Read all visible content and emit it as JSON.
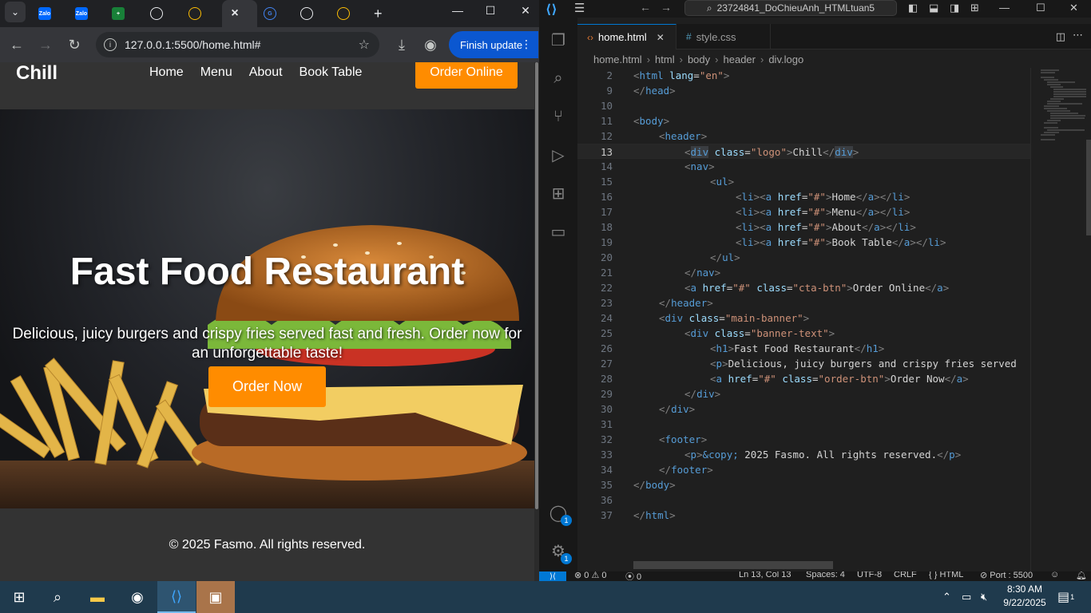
{
  "browser": {
    "tabs": [
      {
        "icon": "zalo-icon",
        "fav_text": "Zalo",
        "color": "#0068ff"
      },
      {
        "icon": "zalo-icon",
        "fav_text": "Zalo",
        "color": "#0068ff"
      },
      {
        "icon": "sheets-icon",
        "fav_text": "+",
        "color": "#188038"
      },
      {
        "icon": "chatgpt-icon",
        "fav_text": "",
        "color": "#e8eaed"
      },
      {
        "icon": "drive-icon",
        "fav_text": "",
        "color": "#fbbc04"
      },
      {
        "icon": "close-icon",
        "fav_text": "×",
        "color": "#e8eaed"
      },
      {
        "icon": "google-icon",
        "fav_text": "G",
        "color": "#4285f4"
      },
      {
        "icon": "github-icon",
        "fav_text": "",
        "color": "#e8eaed"
      },
      {
        "icon": "drive-icon",
        "fav_text": "",
        "color": "#fbbc04"
      }
    ],
    "new_tab": "+",
    "url": "127.0.0.1:5500/home.html#",
    "finish_update": "Finish update"
  },
  "site": {
    "logo": "Chill",
    "nav": [
      "Home",
      "Menu",
      "About",
      "Book Table"
    ],
    "cta": "Order Online",
    "banner_title": "Fast Food Restaurant",
    "banner_desc": "Delicious, juicy burgers and crispy fries served fast and fresh. Order now for an unforgettable taste!",
    "order_btn": "Order Now",
    "footer": "© 2025 Fasmo. All rights reserved.",
    "accent_color": "#ff8c00"
  },
  "vscode": {
    "search": "23724841_DoChieuAnh_HTMLtuan5",
    "tabs": [
      {
        "label": "home.html",
        "icon": "html-icon",
        "active": true
      },
      {
        "label": "style.css",
        "icon": "css-icon",
        "active": false
      }
    ],
    "breadcrumbs": [
      "home.html",
      "html",
      "body",
      "header",
      "div.logo"
    ],
    "lines": [
      {
        "n": "2",
        "indent": 0,
        "html": "<span class='t'>&lt;</span><span class='n'>html</span> <span class='a'>lang</span>=<span class='s'>\"en\"</span><span class='t'>&gt;</span>"
      },
      {
        "n": "9",
        "indent": 0,
        "html": "<span class='t'>&lt;/</span><span class='n'>head</span><span class='t'>&gt;</span>"
      },
      {
        "n": "10",
        "indent": 0,
        "html": ""
      },
      {
        "n": "11",
        "indent": 0,
        "html": "<span class='t'>&lt;</span><span class='n'>body</span><span class='t'>&gt;</span>"
      },
      {
        "n": "12",
        "indent": 1,
        "html": "<span class='t'>&lt;</span><span class='n'>header</span><span class='t'>&gt;</span>"
      },
      {
        "n": "13",
        "indent": 2,
        "html": "<span class='t'>&lt;</span><span class='n hl'>div</span> <span class='a'>class</span>=<span class='s'>\"logo\"</span><span class='t'>&gt;</span><span class='tx'>Chill</span><span class='t'>&lt;/</span><span class='n hl'>div</span><span class='t'>&gt;</span>"
      },
      {
        "n": "14",
        "indent": 2,
        "html": "<span class='t'>&lt;</span><span class='n'>nav</span><span class='t'>&gt;</span>"
      },
      {
        "n": "15",
        "indent": 3,
        "html": "<span class='t'>&lt;</span><span class='n'>ul</span><span class='t'>&gt;</span>"
      },
      {
        "n": "16",
        "indent": 4,
        "html": "<span class='t'>&lt;</span><span class='n'>li</span><span class='t'>&gt;&lt;</span><span class='n'>a</span> <span class='a'>href</span>=<span class='s'>\"#\"</span><span class='t'>&gt;</span><span class='tx'>Home</span><span class='t'>&lt;/</span><span class='n'>a</span><span class='t'>&gt;&lt;/</span><span class='n'>li</span><span class='t'>&gt;</span>"
      },
      {
        "n": "17",
        "indent": 4,
        "html": "<span class='t'>&lt;</span><span class='n'>li</span><span class='t'>&gt;&lt;</span><span class='n'>a</span> <span class='a'>href</span>=<span class='s'>\"#\"</span><span class='t'>&gt;</span><span class='tx'>Menu</span><span class='t'>&lt;/</span><span class='n'>a</span><span class='t'>&gt;&lt;/</span><span class='n'>li</span><span class='t'>&gt;</span>"
      },
      {
        "n": "18",
        "indent": 4,
        "html": "<span class='t'>&lt;</span><span class='n'>li</span><span class='t'>&gt;&lt;</span><span class='n'>a</span> <span class='a'>href</span>=<span class='s'>\"#\"</span><span class='t'>&gt;</span><span class='tx'>About</span><span class='t'>&lt;/</span><span class='n'>a</span><span class='t'>&gt;&lt;/</span><span class='n'>li</span><span class='t'>&gt;</span>"
      },
      {
        "n": "19",
        "indent": 4,
        "html": "<span class='t'>&lt;</span><span class='n'>li</span><span class='t'>&gt;&lt;</span><span class='n'>a</span> <span class='a'>href</span>=<span class='s'>\"#\"</span><span class='t'>&gt;</span><span class='tx'>Book Table</span><span class='t'>&lt;/</span><span class='n'>a</span><span class='t'>&gt;&lt;/</span><span class='n'>li</span><span class='t'>&gt;</span>"
      },
      {
        "n": "20",
        "indent": 3,
        "html": "<span class='t'>&lt;/</span><span class='n'>ul</span><span class='t'>&gt;</span>"
      },
      {
        "n": "21",
        "indent": 2,
        "html": "<span class='t'>&lt;/</span><span class='n'>nav</span><span class='t'>&gt;</span>"
      },
      {
        "n": "22",
        "indent": 2,
        "html": "<span class='t'>&lt;</span><span class='n'>a</span> <span class='a'>href</span>=<span class='s'>\"#\"</span> <span class='a'>class</span>=<span class='s'>\"cta-btn\"</span><span class='t'>&gt;</span><span class='tx'>Order Online</span><span class='t'>&lt;/</span><span class='n'>a</span><span class='t'>&gt;</span>"
      },
      {
        "n": "23",
        "indent": 1,
        "html": "<span class='t'>&lt;/</span><span class='n'>header</span><span class='t'>&gt;</span>"
      },
      {
        "n": "24",
        "indent": 1,
        "html": "<span class='t'>&lt;</span><span class='n'>div</span> <span class='a'>class</span>=<span class='s'>\"main-banner\"</span><span class='t'>&gt;</span>"
      },
      {
        "n": "25",
        "indent": 2,
        "html": "<span class='t'>&lt;</span><span class='n'>div</span> <span class='a'>class</span>=<span class='s'>\"banner-text\"</span><span class='t'>&gt;</span>"
      },
      {
        "n": "26",
        "indent": 3,
        "html": "<span class='t'>&lt;</span><span class='n'>h1</span><span class='t'>&gt;</span><span class='tx'>Fast Food Restaurant</span><span class='t'>&lt;/</span><span class='n'>h1</span><span class='t'>&gt;</span>"
      },
      {
        "n": "27",
        "indent": 3,
        "html": "<span class='t'>&lt;</span><span class='n'>p</span><span class='t'>&gt;</span><span class='tx'>Delicious, juicy burgers and crispy fries served</span>"
      },
      {
        "n": "28",
        "indent": 3,
        "html": "<span class='t'>&lt;</span><span class='n'>a</span> <span class='a'>href</span>=<span class='s'>\"#\"</span> <span class='a'>class</span>=<span class='s'>\"order-btn\"</span><span class='t'>&gt;</span><span class='tx'>Order Now</span><span class='t'>&lt;/</span><span class='n'>a</span><span class='t'>&gt;</span>"
      },
      {
        "n": "29",
        "indent": 2,
        "html": "<span class='t'>&lt;/</span><span class='n'>div</span><span class='t'>&gt;</span>"
      },
      {
        "n": "30",
        "indent": 1,
        "html": "<span class='t'>&lt;/</span><span class='n'>div</span><span class='t'>&gt;</span>"
      },
      {
        "n": "31",
        "indent": 0,
        "html": ""
      },
      {
        "n": "32",
        "indent": 1,
        "html": "<span class='t'>&lt;</span><span class='n'>footer</span><span class='t'>&gt;</span>"
      },
      {
        "n": "33",
        "indent": 2,
        "html": "<span class='t'>&lt;</span><span class='n'>p</span><span class='t'>&gt;</span><span class='n'>&amp;copy;</span><span class='tx'> 2025 Fasmo. All rights reserved.</span><span class='t'>&lt;/</span><span class='n'>p</span><span class='t'>&gt;</span>"
      },
      {
        "n": "34",
        "indent": 1,
        "html": "<span class='t'>&lt;/</span><span class='n'>footer</span><span class='t'>&gt;</span>"
      },
      {
        "n": "35",
        "indent": 0,
        "html": "<span class='t'>&lt;/</span><span class='n'>body</span><span class='t'>&gt;</span>"
      },
      {
        "n": "36",
        "indent": 0,
        "html": ""
      },
      {
        "n": "37",
        "indent": 0,
        "html": "<span class='t'>&lt;/</span><span class='n'>html</span><span class='t'>&gt;</span>"
      }
    ],
    "current_line": "13",
    "status": {
      "errors": "⊗ 0 ⚠ 0",
      "ports_left": "⦿ 0",
      "position": "Ln 13, Col 13",
      "spaces": "Spaces: 4",
      "encoding": "UTF-8",
      "eol": "CRLF",
      "language": "{ } HTML",
      "port": "⊘ Port : 5500"
    },
    "account_badge": "1",
    "settings_badge": "1"
  },
  "taskbar": {
    "time": "8:30 AM",
    "date": "9/22/2025",
    "notifications": "1"
  }
}
